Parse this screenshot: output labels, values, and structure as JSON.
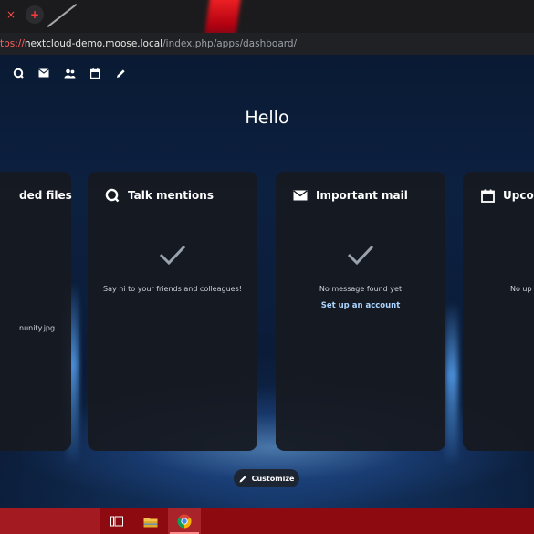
{
  "browser": {
    "url_prefix": "tps://",
    "url_host": "nextcloud-demo.moose.local",
    "url_path": "/index.php/apps/dashboard/",
    "tab_close_glyph": "×",
    "new_tab_glyph": "+"
  },
  "nav": {
    "icons": [
      "talk-icon",
      "mail-icon",
      "contacts-icon",
      "calendar-icon",
      "notes-pencil-icon"
    ]
  },
  "dashboard": {
    "greeting": "Hello",
    "panels": [
      {
        "title": "ded files",
        "icon": "star-icon",
        "file_name": "nunity.jpg"
      },
      {
        "title": "Talk mentions",
        "icon": "talk-icon",
        "empty_message": "Say hi to your friends and colleagues!"
      },
      {
        "title": "Important mail",
        "icon": "mail-icon",
        "empty_message": "No message found yet",
        "action_label": "Set up an account"
      },
      {
        "title": "Upco",
        "icon": "calendar-icon",
        "empty_message": "No up"
      }
    ],
    "customize_label": "Customize"
  },
  "taskbar": {
    "icons": [
      "task-view-icon",
      "file-explorer-icon",
      "chrome-icon"
    ]
  },
  "colors": {
    "page_bg": "#0b1d3a",
    "panel_bg": "#161a21",
    "link": "#a9d4ff",
    "taskbar": "#8d0b10"
  }
}
